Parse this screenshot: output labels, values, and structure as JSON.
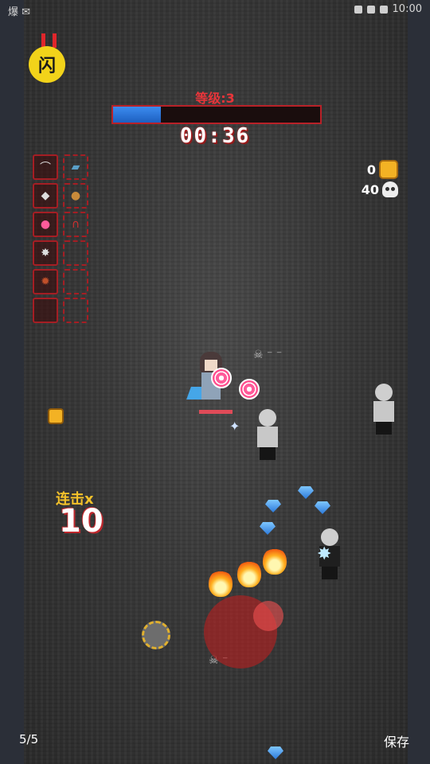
{
  "status_bar": {
    "left_text": "爆 ✉",
    "time": "10:00"
  },
  "hud": {
    "pause_button_label": "闪",
    "level_text": "等级:3",
    "xp_progress": 0.23,
    "timer": "00:36",
    "coins": "0",
    "kills": "40",
    "combo_label": "连击x",
    "combo_value": "10"
  },
  "weapon_slots": [
    {
      "icon": "whip-icon"
    },
    {
      "icon": "star-icon"
    },
    {
      "icon": "lollipop-icon"
    },
    {
      "icon": "mace-icon"
    },
    {
      "icon": "bomb-icon"
    },
    {
      "icon": "empty-slot"
    }
  ],
  "passive_slots": [
    {
      "icon": "helmet-icon"
    },
    {
      "icon": "bread-icon"
    },
    {
      "icon": "magnet-icon"
    },
    {
      "icon": "empty-slot"
    },
    {
      "icon": "empty-slot"
    },
    {
      "icon": "empty-slot"
    }
  ],
  "footer": {
    "page_indicator": "5/5",
    "save_label": "保存"
  },
  "colors": {
    "accent_red": "#e8353a",
    "xp_blue": "#2c79d8",
    "gold": "#f3b224",
    "combo_gold": "#f3c12a"
  }
}
